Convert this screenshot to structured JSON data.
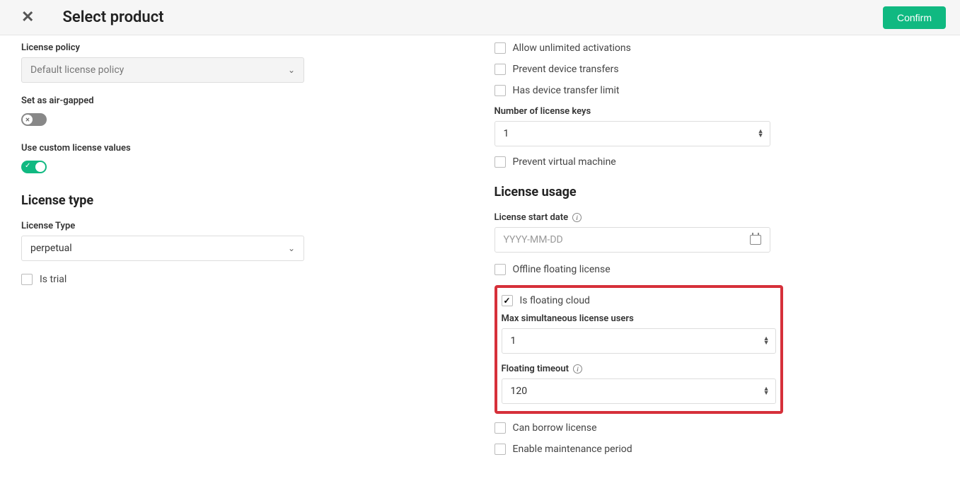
{
  "header": {
    "title": "Select product",
    "confirm": "Confirm"
  },
  "left": {
    "license_policy_label": "License policy",
    "license_policy_value": "Default license policy",
    "air_gapped_label": "Set as air-gapped",
    "custom_values_label": "Use custom license values",
    "section_license_type": "License type",
    "license_type_label": "License Type",
    "license_type_value": "perpetual",
    "is_trial": "Is trial"
  },
  "right": {
    "allow_unlimited": "Allow unlimited activations",
    "prevent_device_transfers": "Prevent device transfers",
    "has_device_transfer_limit": "Has device transfer limit",
    "num_keys_label": "Number of license keys",
    "num_keys_value": "1",
    "prevent_vm": "Prevent virtual machine",
    "section_usage": "License usage",
    "start_date_label": "License start date",
    "start_date_placeholder": "YYYY-MM-DD",
    "offline_floating": "Offline floating license",
    "is_floating_cloud": "Is floating cloud",
    "max_users_label": "Max simultaneous license users",
    "max_users_value": "1",
    "floating_timeout_label": "Floating timeout",
    "floating_timeout_value": "120",
    "can_borrow": "Can borrow license",
    "enable_maintenance": "Enable maintenance period"
  }
}
